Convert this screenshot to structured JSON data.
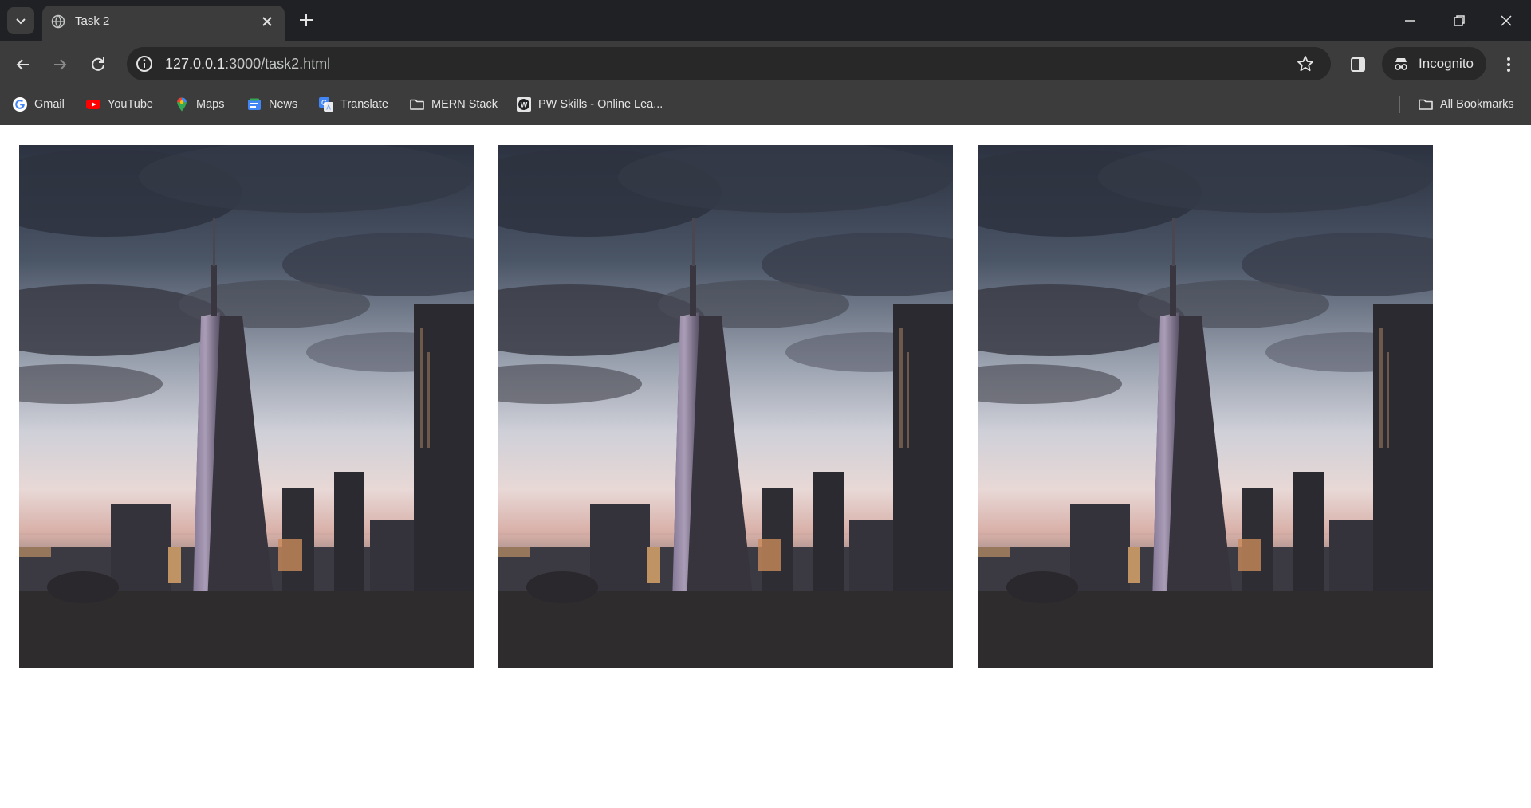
{
  "browser": {
    "tab": {
      "title": "Task 2"
    },
    "address": {
      "host": "127.0.0.1",
      "path": ":3000/task2.html"
    },
    "profile_label": "Incognito"
  },
  "bookmarks": [
    {
      "label": "Gmail",
      "icon": "gmail-icon"
    },
    {
      "label": "YouTube",
      "icon": "youtube-icon"
    },
    {
      "label": "Maps",
      "icon": "maps-icon"
    },
    {
      "label": "News",
      "icon": "news-icon"
    },
    {
      "label": "Translate",
      "icon": "translate-icon"
    },
    {
      "label": "MERN Stack",
      "icon": "folder-icon"
    },
    {
      "label": "PW Skills - Online Lea...",
      "icon": "pw-skills-icon"
    }
  ],
  "all_bookmarks": {
    "label": "All Bookmarks",
    "icon": "folder-icon"
  },
  "page": {
    "images": [
      {
        "subject": "skyscraper-at-dusk"
      },
      {
        "subject": "skyscraper-at-dusk"
      },
      {
        "subject": "skyscraper-at-dusk"
      }
    ]
  },
  "colors": {
    "tabstrip_bg": "#202124",
    "toolbar_bg": "#3c3c3c",
    "omnibox_bg": "#282828",
    "text": "#e3e3e3",
    "page_bg": "#ffffff"
  }
}
